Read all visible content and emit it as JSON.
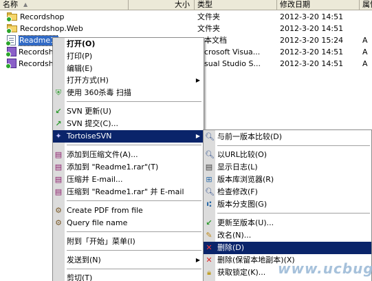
{
  "columns": {
    "name": "名称",
    "size": "大小",
    "type": "类型",
    "modified": "修改日期",
    "attr": "属性"
  },
  "files": [
    {
      "name": "Recordshop",
      "type": "文件夹",
      "date": "2012-3-20 14:51",
      "attr": "",
      "icon": "folder-icon"
    },
    {
      "name": "Recordshop.Web",
      "type": "文件夹",
      "date": "2012-3-20 14:51",
      "attr": "",
      "icon": "folder-icon"
    },
    {
      "name": "Readme1.",
      "type": "本文档",
      "date": "2012-3-20 15:24",
      "attr": "A",
      "icon": "text-document-icon"
    },
    {
      "name": "Recordsh",
      "type": "crosoft Visua...",
      "date": "2012-3-20 14:51",
      "attr": "A",
      "icon": "solution-file-icon"
    },
    {
      "name": "Recordsh",
      "type": "sual Studio S...",
      "date": "2012-3-20 14:51",
      "attr": "A",
      "icon": "solution-file-icon"
    }
  ],
  "context_menu": {
    "open": "打开(O)",
    "print": "打印(P)",
    "edit": "编辑(E)",
    "open_with": "打开方式(H)",
    "scan_360": "使用 360杀毒 扫描",
    "svn_update": "SVN 更新(U)",
    "svn_commit": "SVN 提交(C)...",
    "tortoise_svn": "TortoiseSVN",
    "add_archive": "添加到压缩文件(A)...",
    "add_to_rar": "添加到 \"Readme1.rar\"(T)",
    "compress_email": "压缩并 E-mail...",
    "compress_rar_email": "压缩到 \"Readme1.rar\" 并 E-mail",
    "create_pdf": "Create PDF from file",
    "query_file_name": "Query file name",
    "pin_start": "附到「开始」菜单(I)",
    "send_to": "发送到(N)",
    "cut": "剪切(T)"
  },
  "svn_submenu": {
    "diff_prev": "与前一版本比较(D)",
    "diff_url": "以URL比较(O)",
    "show_log": "显示日志(L)",
    "repo_browser": "版本库浏览器(R)",
    "check_modifications": "检查修改(F)",
    "revision_graph": "版本分支图(G)",
    "update_to_revision": "更新至版本(U)...",
    "rename": "改名(N)...",
    "delete": "删除(D)",
    "delete_keep_local": "删除(保留本地副本)(X)",
    "get_lock": "获取锁定(K)..."
  },
  "watermark": "www.ucbug.cc",
  "colors": {
    "highlight": "#0a246a",
    "selection": "#316ac5",
    "header_bg": "#ece9d8",
    "gutter": "#dcdcdc"
  }
}
